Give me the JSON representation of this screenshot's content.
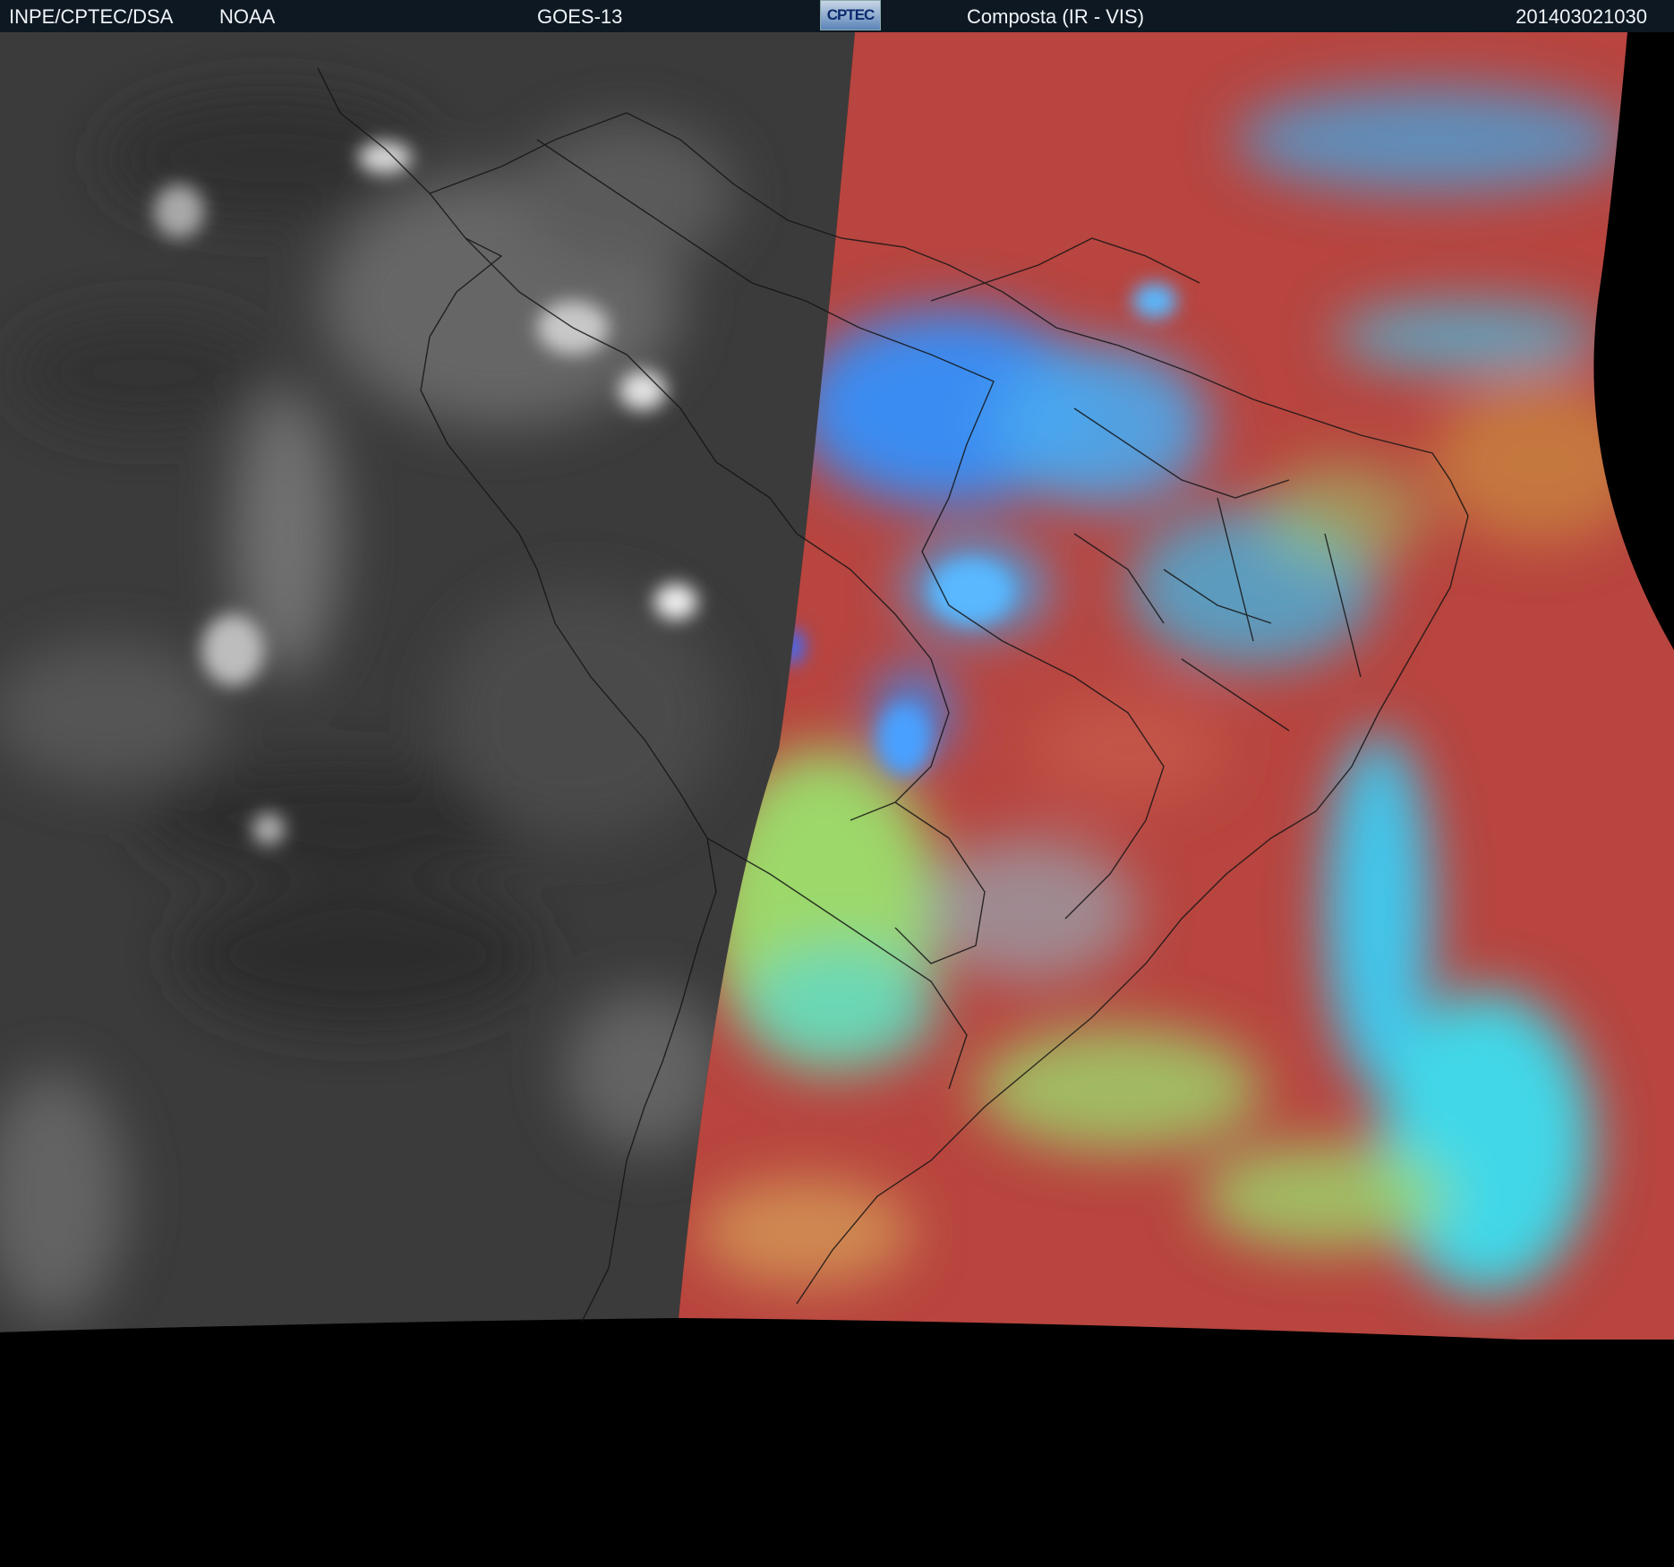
{
  "header": {
    "organization": "INPE/CPTEC/DSA",
    "agency": "NOAA",
    "satellite": "GOES-13",
    "logo_text": "CPTEC",
    "product": "Composta (IR - VIS)",
    "timestamp": "201403021030",
    "background": "#0d1822",
    "text_color": "#f0f4f8"
  },
  "map": {
    "region": "South America",
    "night_side_style": "grayscale-ir",
    "day_side_style": "false-color-composite",
    "colors": {
      "ocean_clear": "#b8453f",
      "land": "#c25548",
      "cloud_low": "#9cd86a",
      "cloud_high": "#3fc8ee",
      "cloud_deep": "#3b8cf2",
      "dust_orange": "#c8843f",
      "night_bg": "#3b3b3b",
      "night_cloud": "#cfcfcf",
      "no_data": "#000000",
      "borders": "#1a1a1a"
    },
    "icons": [
      "coastline-lines",
      "country-borders",
      "state-borders"
    ]
  }
}
